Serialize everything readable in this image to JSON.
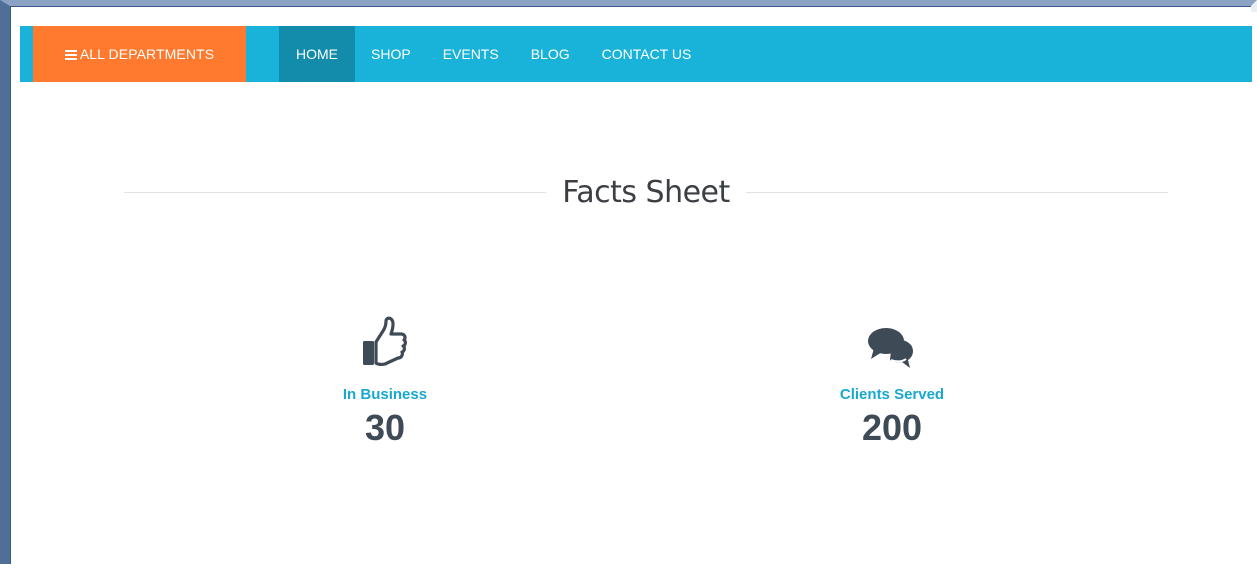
{
  "navbar": {
    "departments_label": "ALL DEPARTMENTS",
    "links": [
      {
        "label": "HOME",
        "active": true
      },
      {
        "label": "SHOP",
        "active": false
      },
      {
        "label": "EVENTS",
        "active": false
      },
      {
        "label": "BLOG",
        "active": false
      },
      {
        "label": "CONTACT US",
        "active": false
      }
    ]
  },
  "facts": {
    "title": "Facts Sheet",
    "items": [
      {
        "label": "In Business",
        "value": "30",
        "icon": "thumbs-up-icon"
      },
      {
        "label": "Clients Served",
        "value": "200",
        "icon": "chat-bubbles-icon"
      }
    ]
  },
  "colors": {
    "navbar_bg": "#19b3d9",
    "departments_bg": "#ff7a2e",
    "active_nav_bg": "#138cab",
    "fact_label": "#19a8cf",
    "fact_value": "#3f4a57"
  }
}
